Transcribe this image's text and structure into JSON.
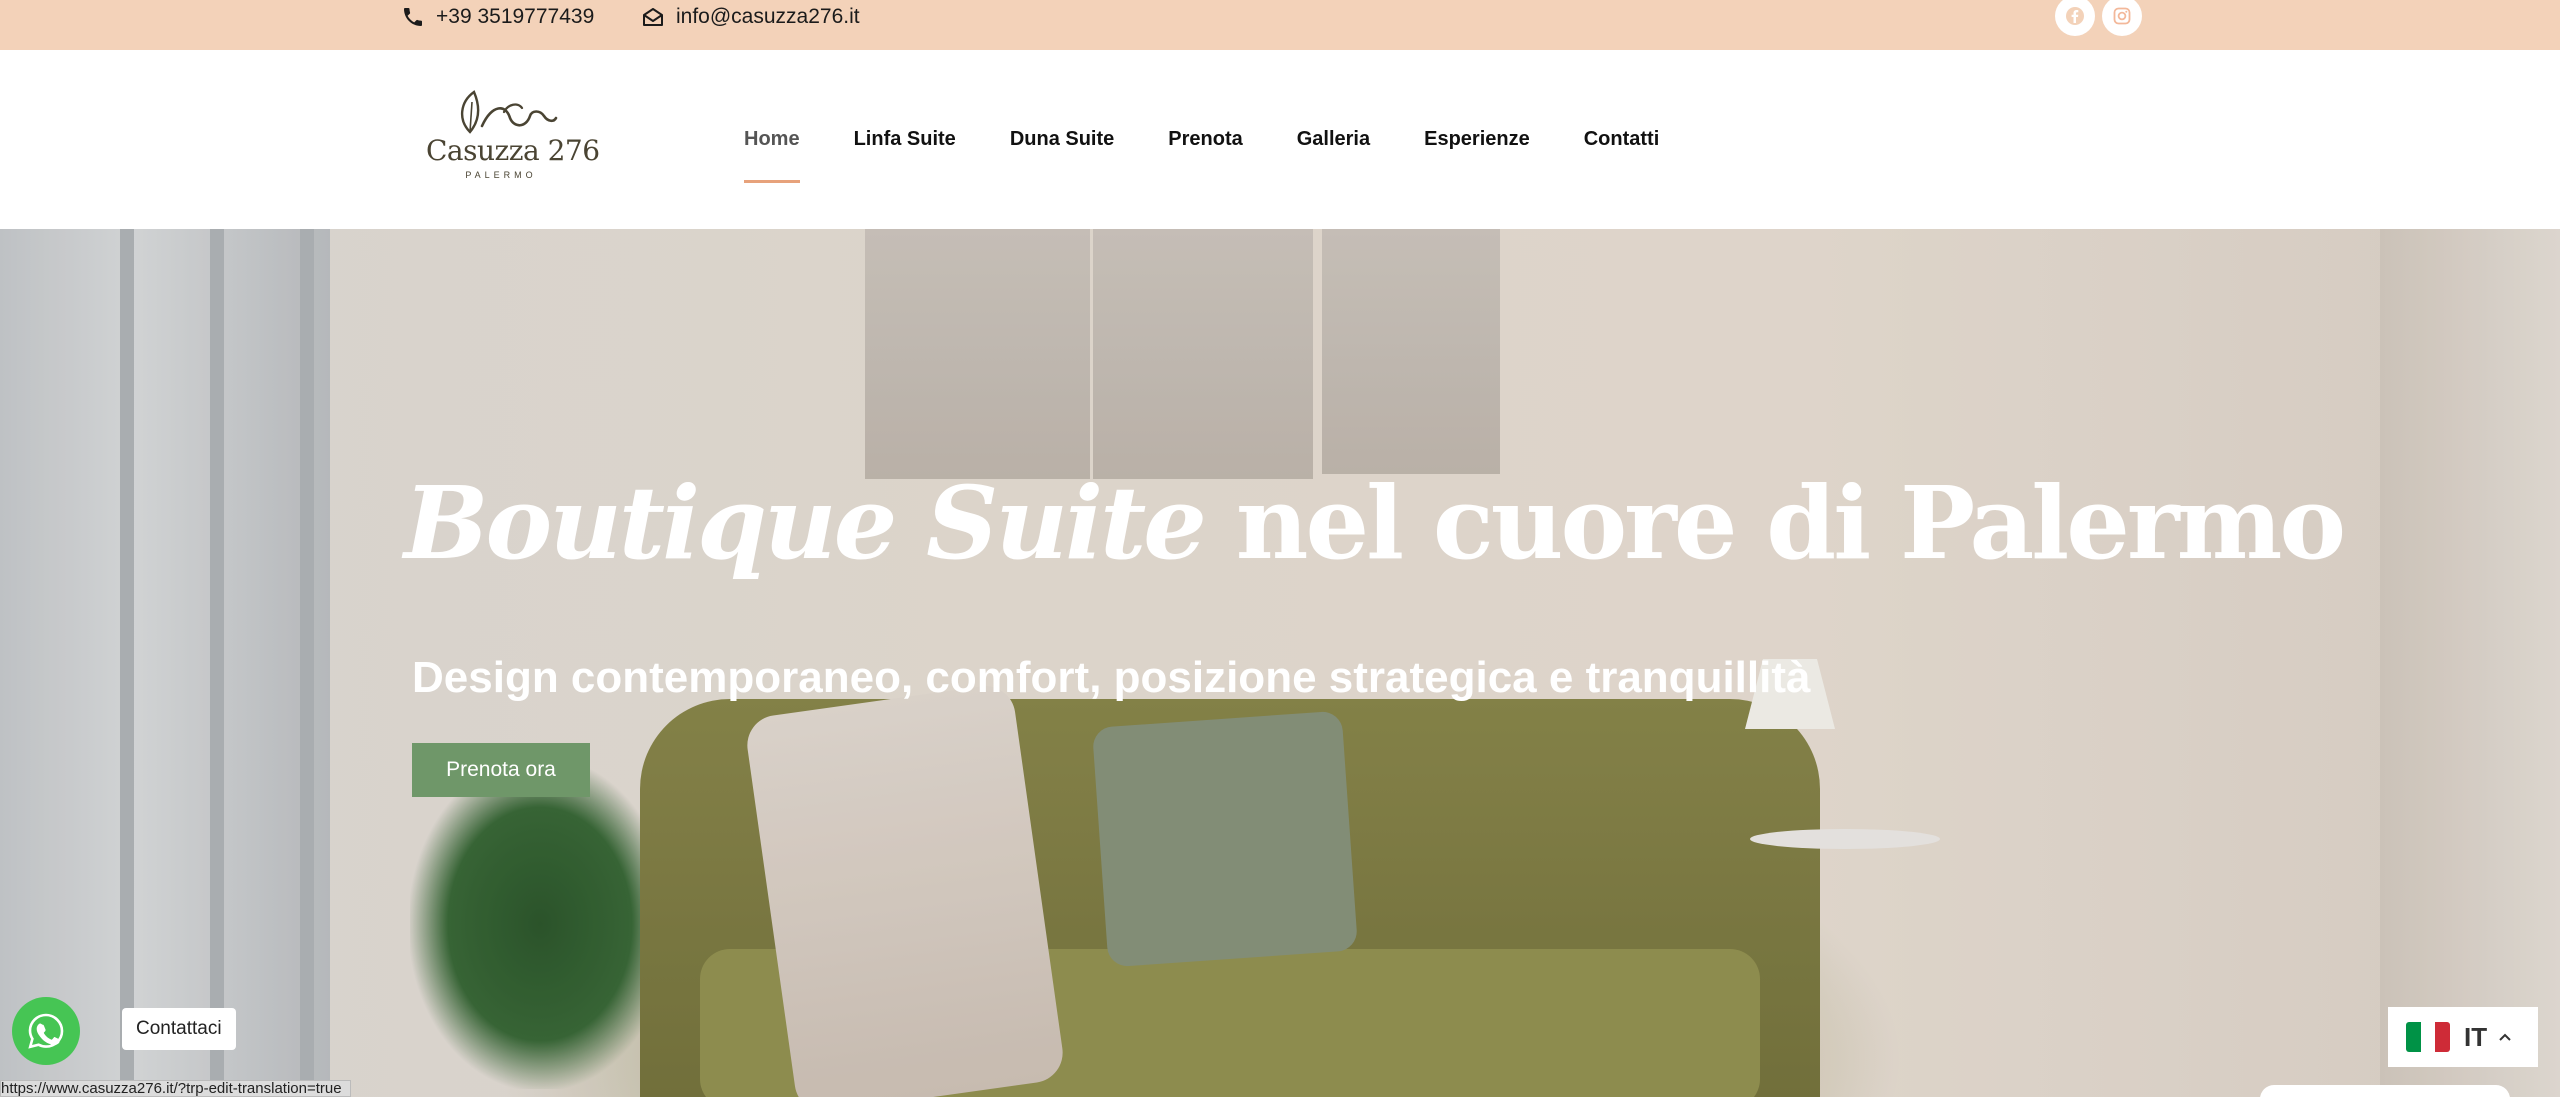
{
  "topbar": {
    "phone": "+39 3519777439",
    "email": "info@casuzza276.it",
    "social": [
      {
        "icon": "facebook-icon"
      },
      {
        "icon": "instagram-icon"
      }
    ]
  },
  "logo": {
    "name": "Casuzza 276",
    "city": "PALERMO"
  },
  "nav": {
    "items": [
      "Home",
      "Linfa Suite",
      "Duna Suite",
      "Prenota",
      "Galleria",
      "Esperienze",
      "Contatti"
    ],
    "active": "Home"
  },
  "hero": {
    "title_em": "Boutique Suite",
    "title_rest": "nel cuore di Palermo",
    "subtitle": "Design contemporaneo, comfort, posizione strategica e tranquillità",
    "cta": "Prenota ora"
  },
  "whatsapp": {
    "label": "Contattaci"
  },
  "statusbar": {
    "url": "https://www.casuzza276.it/?trp-edit-translation=true"
  },
  "language": {
    "code": "IT",
    "flag_colors": [
      "#009246",
      "#ffffff",
      "#ce2b37"
    ]
  },
  "colors": {
    "topbar_bg": "#f3d2b9",
    "accent_underline": "#e7a27b",
    "cta_bg": "#6f9769",
    "whatsapp": "#46c554"
  }
}
